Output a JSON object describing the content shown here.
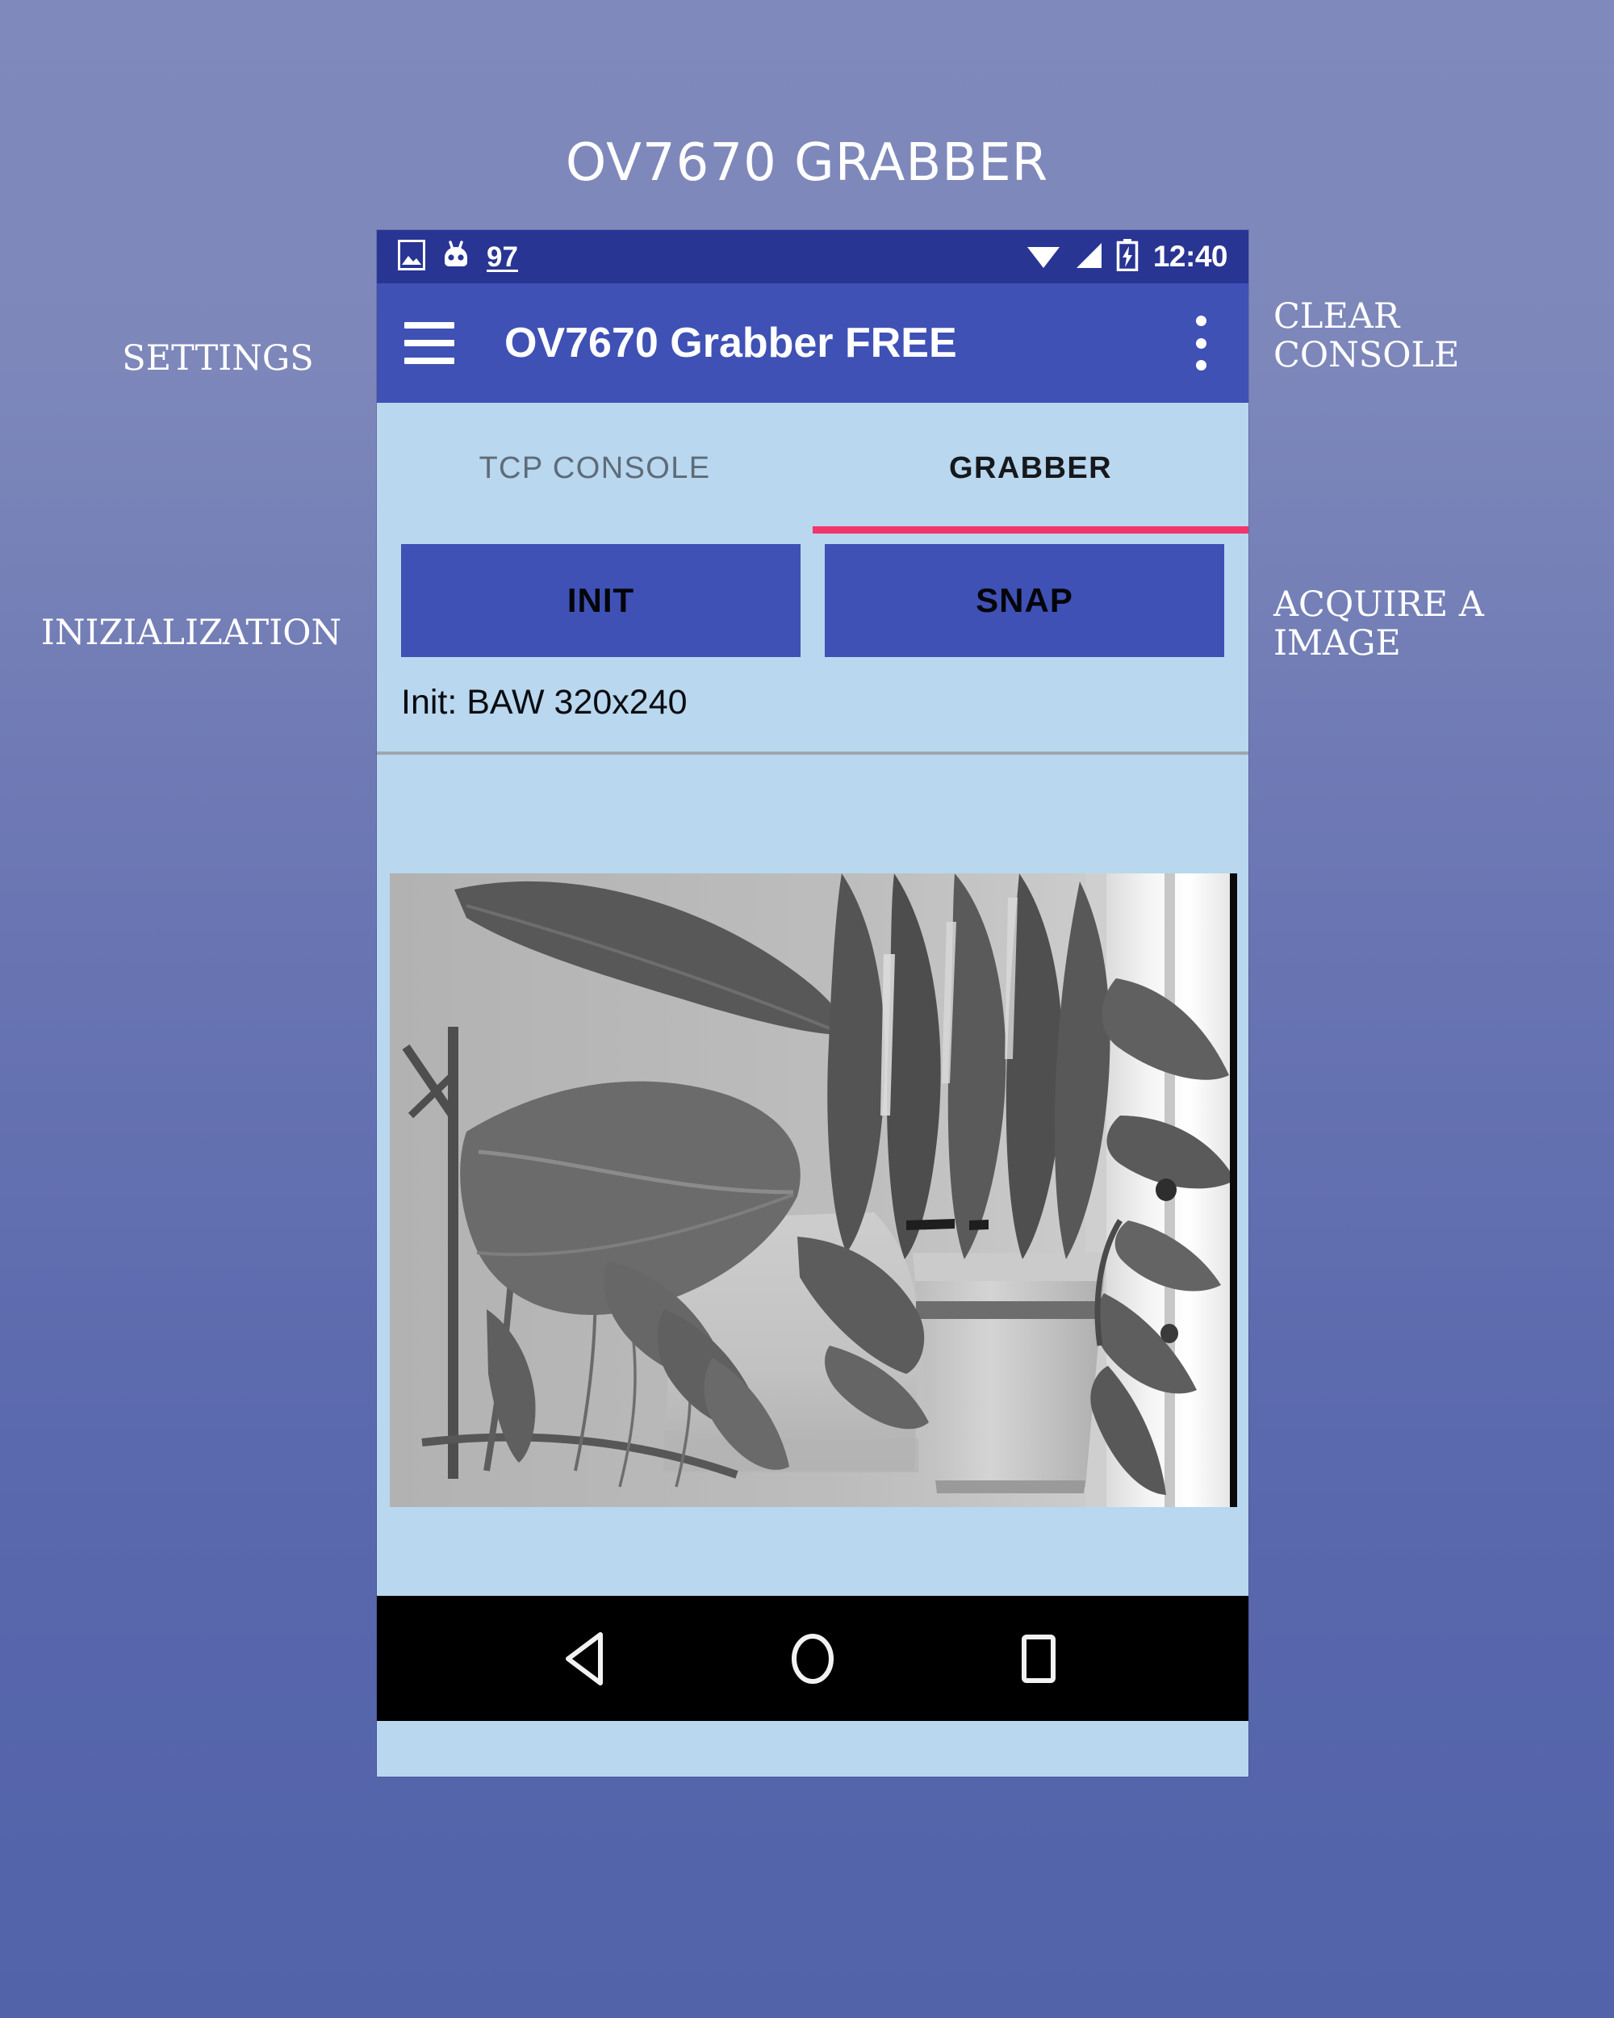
{
  "slide": {
    "title": "OV7670 GRABBER",
    "annotations": {
      "settings": "SETTINGS",
      "inizialization": "INIZIALIZATION",
      "clear_console": "CLEAR CONSOLE",
      "acquire_image": "ACQUIRE A IMAGE"
    }
  },
  "phone": {
    "status_bar": {
      "battery_percent": "97",
      "clock": "12:40",
      "icons": [
        "image-icon",
        "cyanogenmod-icon",
        "wifi-icon",
        "signal-icon",
        "battery-charging-icon"
      ]
    },
    "app_bar": {
      "menu_icon": "hamburger-menu-icon",
      "title": "OV7670 Grabber FREE",
      "overflow_icon": "overflow-menu-icon"
    },
    "tabs": [
      {
        "label": "TCP CONSOLE",
        "active": false
      },
      {
        "label": "GRABBER",
        "active": true
      }
    ],
    "buttons": [
      {
        "label": "INIT"
      },
      {
        "label": "SNAP"
      }
    ],
    "status_text": "Init: BAW 320x240",
    "preview": {
      "alt": "grayscale photo of a potted plant near a window"
    },
    "nav_bar": [
      {
        "icon": "back-triangle-icon"
      },
      {
        "icon": "home-circle-icon"
      },
      {
        "icon": "recents-square-icon"
      }
    ]
  },
  "colors": {
    "page_background_top": "#8089bb",
    "page_background_bottom": "#5263a9",
    "status_bar": "#283593",
    "app_bar": "#3f51b5",
    "card": "#b9d7ee",
    "tab_indicator": "#f2356b",
    "button": "#3f51b5",
    "nav_bar": "#000000"
  }
}
